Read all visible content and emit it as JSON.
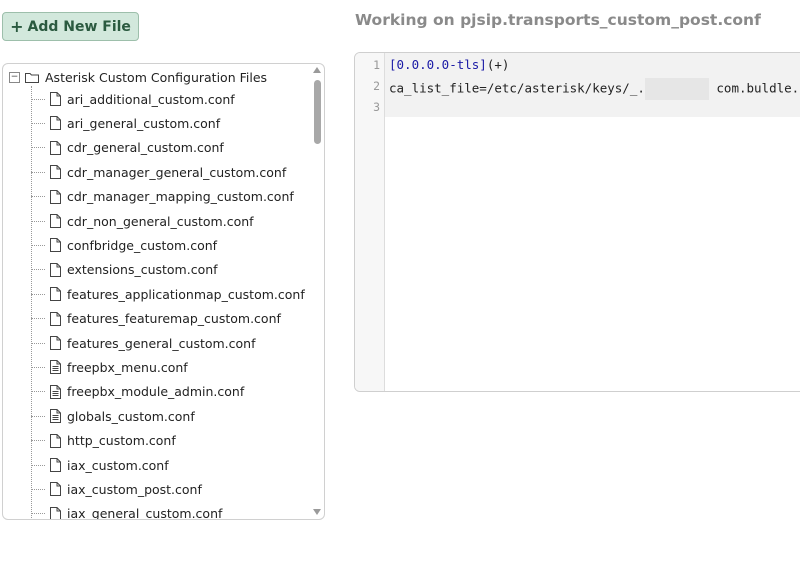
{
  "toolbar": {
    "add_label": "Add New File",
    "add_icon": "plus-icon"
  },
  "tree": {
    "root": {
      "label": "Asterisk Custom Configuration Files",
      "icon": "folder-icon",
      "expander_icon": "minus-icon"
    },
    "files": [
      {
        "label": "ari_additional_custom.conf",
        "icon": "file-icon"
      },
      {
        "label": "ari_general_custom.conf",
        "icon": "file-icon"
      },
      {
        "label": "cdr_general_custom.conf",
        "icon": "file-icon"
      },
      {
        "label": "cdr_manager_general_custom.conf",
        "icon": "file-icon"
      },
      {
        "label": "cdr_manager_mapping_custom.conf",
        "icon": "file-icon"
      },
      {
        "label": "cdr_non_general_custom.conf",
        "icon": "file-icon"
      },
      {
        "label": "confbridge_custom.conf",
        "icon": "file-icon"
      },
      {
        "label": "extensions_custom.conf",
        "icon": "file-icon"
      },
      {
        "label": "features_applicationmap_custom.conf",
        "icon": "file-icon"
      },
      {
        "label": "features_featuremap_custom.conf",
        "icon": "file-icon"
      },
      {
        "label": "features_general_custom.conf",
        "icon": "file-icon"
      },
      {
        "label": "freepbx_menu.conf",
        "icon": "file-text-icon"
      },
      {
        "label": "freepbx_module_admin.conf",
        "icon": "file-text-icon"
      },
      {
        "label": "globals_custom.conf",
        "icon": "file-text-icon"
      },
      {
        "label": "http_custom.conf",
        "icon": "file-icon"
      },
      {
        "label": "iax_custom.conf",
        "icon": "file-icon"
      },
      {
        "label": "iax_custom_post.conf",
        "icon": "file-icon"
      },
      {
        "label": "iax_general_custom.conf",
        "icon": "file-icon"
      }
    ]
  },
  "editor": {
    "title": "Working on pjsip.transports_custom_post.conf",
    "line_numbers": [
      "1",
      "2",
      "3"
    ],
    "line1_section": "[0.0.0.0-tls]",
    "line1_suffix": "(+)",
    "line2_prefix": "ca_list_file=/etc/asterisk/keys/_.",
    "line2_suffix": "com.buldle.crt"
  }
}
